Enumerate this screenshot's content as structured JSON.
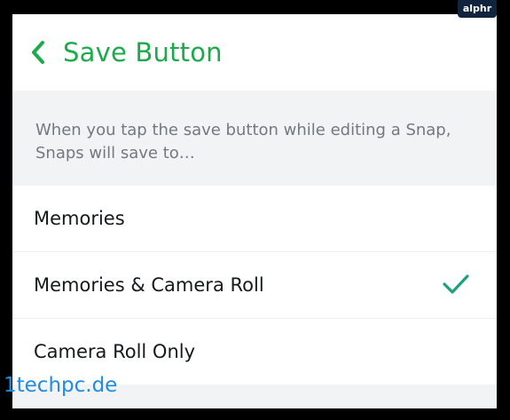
{
  "header": {
    "back_icon": "chevron-left-icon",
    "title": "Save Button"
  },
  "description": "When you tap the save button while editing a Snap, Snaps will save to…",
  "options": [
    {
      "label": "Memories",
      "selected": false
    },
    {
      "label": "Memories & Camera Roll",
      "selected": true
    },
    {
      "label": "Camera Roll Only",
      "selected": false
    }
  ],
  "brand_badge": "alphr",
  "watermark": "1techpc.de",
  "colors": {
    "accent": "#1bab4a",
    "check": "#1aa27f",
    "description_text": "#727981",
    "background": "#f2f3f5"
  }
}
